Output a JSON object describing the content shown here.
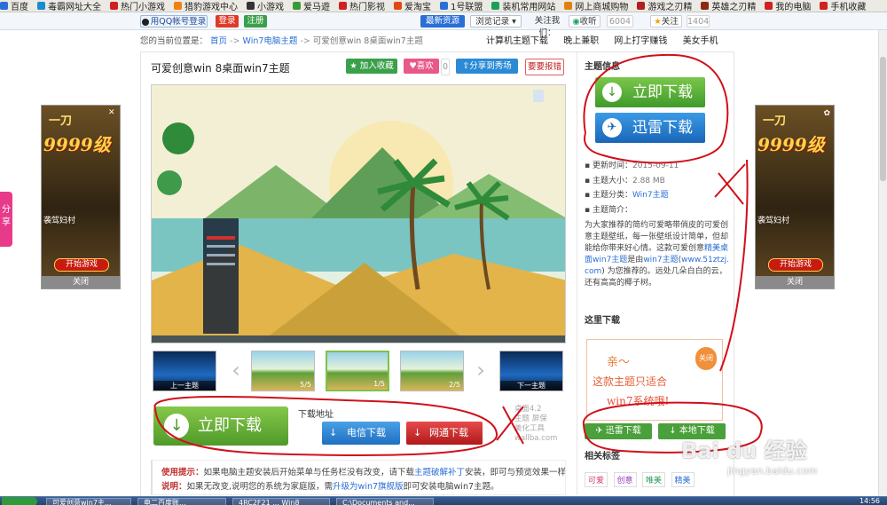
{
  "favorites": [
    "百度",
    "毒霸网址大全",
    "热门小游戏",
    "猎豹游戏中心",
    "小游戏",
    "爱马遊",
    "热门影视",
    "爱淘宝",
    "1号联盟",
    "装机常用网站",
    "网上商城购物",
    "游戏之刃精",
    "英雄之刃精",
    "我的电脑",
    "手机收藏"
  ],
  "topbar": {
    "qq_login": "用QQ帐号登录",
    "login": "登录",
    "register": "注册",
    "latest": "最新资源",
    "history": "浏览记录",
    "follow_us": "关注我们：",
    "collect": "收听",
    "collect_count": "6004",
    "follow": "关注",
    "follow_count": "1404"
  },
  "breadcrumb": {
    "prefix": "您的当前位置是：",
    "home": "首页",
    "sep1": "->",
    "cat": "Win7电脑主题",
    "sep2": "->",
    "current": "可爱创意win 8桌面win7主题"
  },
  "right_links": [
    "计算机主题下载",
    "晚上兼职",
    "网上打字赚钱",
    "美女手机"
  ],
  "page": {
    "title": "可爱创意win 8桌面win7主题",
    "btn_add": "加入收藏",
    "btn_like": "喜欢",
    "like_count": "0",
    "btn_share": "分享到秀场",
    "btn_report": "要要报错"
  },
  "thumbs": [
    {
      "caption": "上一主题"
    },
    {
      "num": "5/5"
    },
    {
      "num": "1/5"
    },
    {
      "num": "2/5"
    },
    {
      "caption": "下一主题"
    }
  ],
  "download_area": {
    "big_btn": "立即下载",
    "addr_label": "下载地址",
    "telecom": "电信下载",
    "netcom": "网通下载",
    "wm1": "桌面4.2",
    "wm2": "主题 屏保",
    "wm3": "美化工具",
    "wm4": "wallba.com"
  },
  "tips": {
    "label": "使用提示：",
    "text": "如果电脑主题安装后开始菜单与任务栏没有改变，请下载",
    "link": "主题破解补丁",
    "text2": "安装，即可与预览效果一样。",
    "label2": "说明：",
    "text3": "如果无改变,说明您的系统为家庭版，需",
    "link2": "升级为win7旗舰版",
    "text4": "即可安装电脑win7主题。"
  },
  "sidebar": {
    "heading": "主题信息",
    "dl_now": "立即下载",
    "xunlei": "迅雷下载",
    "update_label": "更新时间：",
    "update": "2015-09-11",
    "size_label": "主题大小：",
    "size": "2.88 MB",
    "cat_label": "主题分类：",
    "cat": "Win7主题",
    "intro_label": "主题简介：",
    "intro": "为大家推荐的简约可爱略带俏皮的可爱创意主题壁纸，每一张壁纸设计简单，但却能给你带来好心情。这款可爱创意",
    "intro_link": "精美桌面win7主题",
    "intro2": "是由",
    "intro_link2": "win7主题",
    "intro3": "(",
    "intro_link3": "www.51ztzj.com",
    "intro4": ") 为您推荐的。远处几朵白白的云，还有高高的椰子树。",
    "here_download": "这里下载",
    "banner_l1": "亲～",
    "banner_l2": "这款主题只适合",
    "banner_l3": "win7系统哦!",
    "banner_close": "关闭",
    "dl_xunlei": "迅雷下载",
    "dl_local": "本地下载",
    "tags_heading": "相关标签",
    "tags": [
      "可爱",
      "创意",
      "唯美",
      "精美"
    ]
  },
  "ads": {
    "title": "一刀",
    "level": "9999级",
    "caption": "袭驾妇村",
    "play": "开始游戏",
    "close": "关闭"
  },
  "share_tab": "分享",
  "watermark": {
    "brand": "Bai du 经验",
    "url": "jingyan.baidu.com"
  },
  "taskbar": [
    "可爱创意win7主...",
    "电二百度账...",
    "4RC2F21 ... Win8",
    "C:\\Documents and..."
  ],
  "clock": "14:56"
}
